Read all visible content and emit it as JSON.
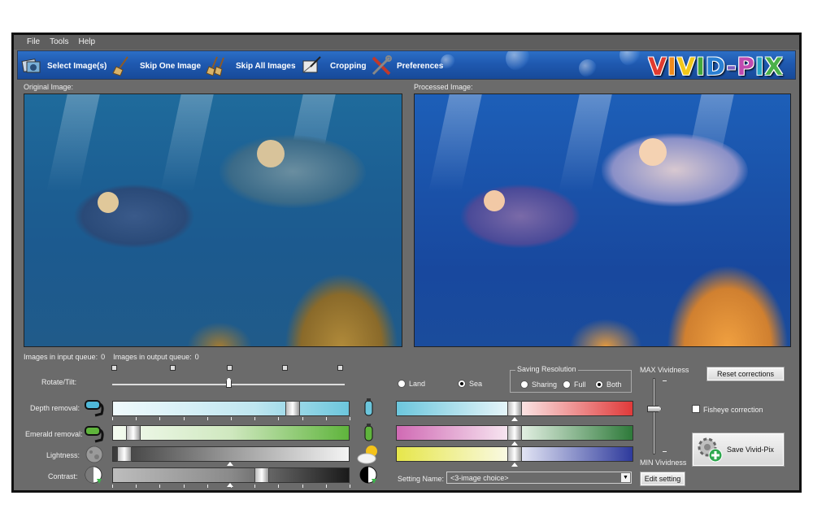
{
  "menu": [
    "File",
    "Tools",
    "Help"
  ],
  "toolbar": {
    "select": "Select Image(s)",
    "skip_one": "Skip One Image",
    "skip_all": "Skip All Images",
    "cropping": "Cropping",
    "preferences": "Preferences",
    "logo": "VIVID-PIX"
  },
  "panels": {
    "original": "Original Image:",
    "processed": "Processed Image:"
  },
  "queue": {
    "input_label": "Images in input queue:",
    "input_count": "0",
    "output_label": "Images in output queue:",
    "output_count": "0"
  },
  "controls": {
    "rotate": "Rotate/Tilt:",
    "depth": "Depth removal:",
    "emerald": "Emerald removal:",
    "lightness": "Lightness:",
    "contrast": "Contrast:",
    "depth_value": 0.78,
    "emerald_value": 0.06,
    "lightness_value": 0.02,
    "contrast_value": 0.64,
    "rotate_value": 0.5
  },
  "environment": {
    "land": "Land",
    "sea": "Sea",
    "selected": "Sea"
  },
  "saving": {
    "title": "Saving Resolution",
    "sharing": "Sharing",
    "full": "Full",
    "both": "Both",
    "selected": "Both"
  },
  "color_sliders": {
    "cyan_red": 0.5,
    "magenta_green": 0.5,
    "yellow_blue": 0.5
  },
  "setting": {
    "label": "Setting Name:",
    "value": "<3-image choice>",
    "edit": "Edit setting"
  },
  "vividness": {
    "max": "MAX Vividness",
    "min": "MIN Vividness",
    "value": 0.62
  },
  "actions": {
    "reset": "Reset corrections",
    "fisheye": "Fisheye correction",
    "fisheye_checked": false,
    "save": "Save Vivid-Pix"
  },
  "colors": {
    "window_bg": "#6b6b6b",
    "toolbar_blue": "#1f59b0",
    "depth_cyan": "#6cc6dc",
    "emerald_green": "#5fb43c",
    "red": "#e03a3a",
    "magenta": "#d06ab4",
    "blue": "#2e3a9c",
    "yellow": "#e6e64a"
  }
}
